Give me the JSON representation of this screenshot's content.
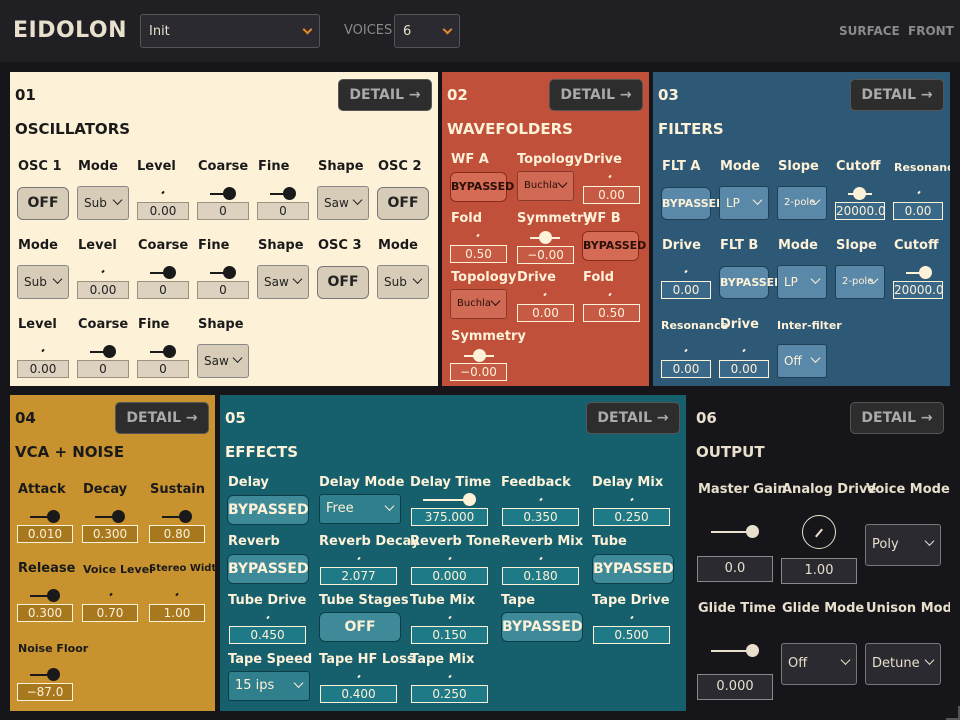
{
  "header": {
    "brand": "EIDOLON",
    "preset": "Init",
    "voices_label": "VOICES",
    "voices": "6",
    "links": [
      "SURFACE",
      "FRONT"
    ]
  },
  "detail_label": "DETAIL →",
  "osc": {
    "num": "01",
    "title": "OSCILLATORS",
    "osc1_label": "OSC 1",
    "osc1": "OFF",
    "mode1_label": "Mode",
    "mode1": "Sub",
    "level1_label": "Level",
    "level1": "0.00",
    "coarse1_label": "Coarse",
    "coarse1": "0",
    "fine1_label": "Fine",
    "fine1": "0",
    "shape1_label": "Shape",
    "shape1": "Saw",
    "osc2_label": "OSC 2",
    "osc2": "OFF",
    "mode2_label": "Mode",
    "mode2": "Sub",
    "level2_label": "Level",
    "level2": "0.00",
    "coarse2_label": "Coarse",
    "coarse2": "0",
    "fine2_label": "Fine",
    "fine2": "0",
    "shape2_label": "Shape",
    "shape2": "Saw",
    "osc3_label": "OSC 3",
    "osc3": "OFF",
    "mode3_label": "Mode",
    "mode3": "Sub",
    "level3_label": "Level",
    "level3": "0.00",
    "coarse3_label": "Coarse",
    "coarse3": "0",
    "fine3_label": "Fine",
    "fine3": "0",
    "shape3_label": "Shape",
    "shape3": "Saw"
  },
  "wf": {
    "num": "02",
    "title": "WAVEFOLDERS",
    "wfa_label": "WF A",
    "wfa": "BYPASSED",
    "topo1_label": "Topology",
    "topo1": "Buchla",
    "drive1_label": "Drive",
    "drive1": "0.00",
    "fold1_label": "Fold",
    "fold1": "0.50",
    "sym1_label": "Symmetry",
    "sym1": "−0.00",
    "wfb_label": "WF B",
    "wfb": "BYPASSED",
    "topo2_label": "Topology",
    "topo2": "Buchla",
    "drive2_label": "Drive",
    "drive2": "0.00",
    "fold2_label": "Fold",
    "fold2": "0.50",
    "sym2_label": "Symmetry",
    "sym2": "−0.00"
  },
  "flt": {
    "num": "03",
    "title": "FILTERS",
    "flta_label": "FLT A",
    "flta": "BYPASSED",
    "mode1_label": "Mode",
    "mode1": "LP",
    "slope1_label": "Slope",
    "slope1": "2-pole",
    "cutoff1_label": "Cutoff",
    "cutoff1": "20000.0",
    "res1_label": "Resonance",
    "res1": "0.00",
    "drive1_label": "Drive",
    "drive1": "0.00",
    "fltb_label": "FLT B",
    "fltb": "BYPASSED",
    "mode2_label": "Mode",
    "mode2": "LP",
    "slope2_label": "Slope",
    "slope2": "2-pole",
    "cutoff2_label": "Cutoff",
    "cutoff2": "20000.0",
    "res2_label": "Resonance",
    "res2": "0.00",
    "drive2_label": "Drive",
    "drive2": "0.00",
    "inter_label": "Inter-filter",
    "inter": "Off"
  },
  "vca": {
    "num": "04",
    "title": "VCA + NOISE",
    "attack_label": "Attack",
    "attack": "0.010",
    "decay_label": "Decay",
    "decay": "0.300",
    "sustain_label": "Sustain",
    "sustain": "0.80",
    "release_label": "Release",
    "release": "0.300",
    "vlevel_label": "Voice Level",
    "vlevel": "0.70",
    "width_label": "Stereo Width",
    "width": "1.00",
    "noise_label": "Noise Floor",
    "noise": "−87.0"
  },
  "fx": {
    "num": "05",
    "title": "EFFECTS",
    "delay_label": "Delay",
    "delay": "BYPASSED",
    "dmode_label": "Delay Mode",
    "dmode": "Free",
    "dtime_label": "Delay Time",
    "dtime": "375.000",
    "fb_label": "Feedback",
    "fb": "0.350",
    "dmix_label": "Delay Mix",
    "dmix": "0.250",
    "reverb_label": "Reverb",
    "reverb": "BYPASSED",
    "rdecay_label": "Reverb Decay",
    "rdecay": "2.077",
    "rtone_label": "Reverb Tone",
    "rtone": "0.000",
    "rmix_label": "Reverb Mix",
    "rmix": "0.180",
    "tube_label": "Tube",
    "tube": "BYPASSED",
    "tdrive_label": "Tube Drive",
    "tdrive": "0.450",
    "tstages_label": "Tube Stages",
    "tstages": "OFF",
    "tmix_label": "Tube Mix",
    "tmix": "0.150",
    "tape_label": "Tape",
    "tape": "BYPASSED",
    "tapedrive_label": "Tape Drive",
    "tapedrive": "0.500",
    "tspeed_label": "Tape Speed",
    "tspeed": "15 ips",
    "thf_label": "Tape HF Loss",
    "thf": "0.400",
    "tapemix_label": "Tape Mix",
    "tapemix": "0.250"
  },
  "out": {
    "num": "06",
    "title": "OUTPUT",
    "mgain_label": "Master Gain",
    "mgain": "0.0",
    "adrive_label": "Analog Drive",
    "adrive": "1.00",
    "vmode_label": "Voice Mode",
    "vmode": "Poly",
    "glide_label": "Glide Time",
    "glide": "0.000",
    "gmode_label": "Glide Mode",
    "gmode": "Off",
    "umode_label": "Unison Mode",
    "umode": "Detune"
  }
}
